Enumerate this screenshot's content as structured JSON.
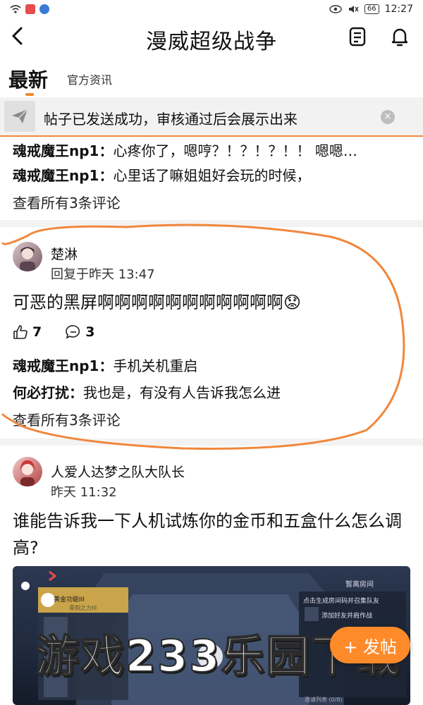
{
  "status_bar": {
    "time": "12:27",
    "battery": "66"
  },
  "header": {
    "back_glyph": "<",
    "title": "漫威超级战争"
  },
  "tabs": {
    "latest": "最新",
    "news": "官方资讯"
  },
  "toast": {
    "message": "帖子已发送成功，审核通过后会展示出来",
    "close_glyph": "×"
  },
  "prev_post": {
    "comments": [
      {
        "author": "魂戒魔王np1：",
        "text": "心疼你了，嗯哼？！？！？！！ 嗯嗯…"
      },
      {
        "author": "魂戒魔王np1：",
        "text": "心里话了嘛姐姐好会玩的时候，"
      }
    ],
    "view_all": "查看所有3条评论"
  },
  "post1": {
    "user": "楚淋",
    "time": "回复于昨天 13:47",
    "text": "可恶的黑屏啊啊啊啊啊啊啊啊啊啊啊",
    "emoji": "😟",
    "likes": "7",
    "comments_count": "3",
    "comments": [
      {
        "author": "魂戒魔王np1：",
        "text": "手机关机重启"
      },
      {
        "author": "何必打扰：",
        "text": "我也是，有没有人告诉我怎么进"
      }
    ],
    "view_all": "查看所有3条评论"
  },
  "post2": {
    "user": "人爱人达梦之队大队长",
    "time": "昨天 11:32",
    "text": "谁能告诉我一下人机试炼你的金币和五盒什么怎么调高?"
  },
  "game_screenshot": {
    "panel_title": "黄金功能III",
    "panel_sub": "青铜之力III",
    "room_btn": "暂离房间",
    "invite_title": "点击生成房间码并召集队友",
    "invite_action": "添加好友并肩作战",
    "invite_list": "邀请列表 (0/8)"
  },
  "fab": {
    "label": "+ 发帖"
  },
  "watermark": "游戏233乐园下载",
  "colors": {
    "accent": "#ff8a2a",
    "annotation": "#f0873c"
  }
}
